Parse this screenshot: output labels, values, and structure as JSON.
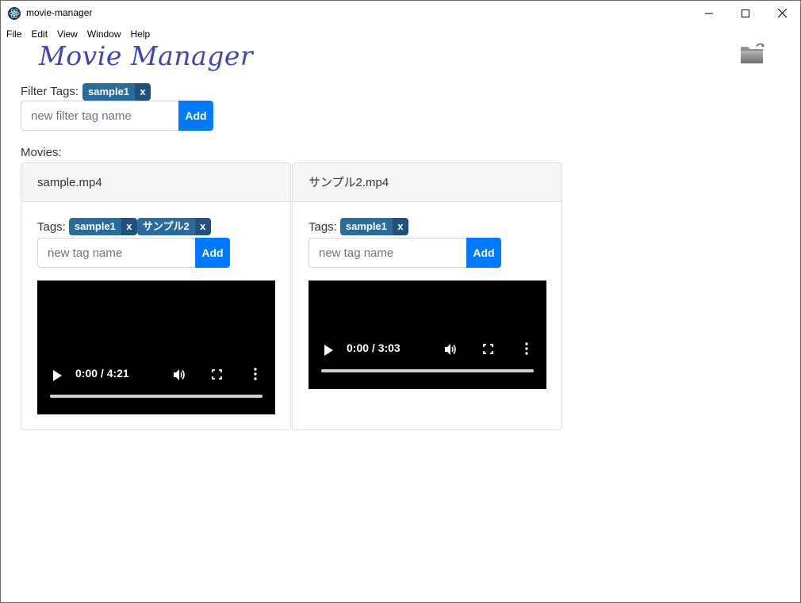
{
  "window": {
    "title": "movie-manager"
  },
  "menu": {
    "items": [
      "File",
      "Edit",
      "View",
      "Window",
      "Help"
    ]
  },
  "app": {
    "title": "Movie Manager",
    "folder_icon": "folder-open-icon"
  },
  "filter": {
    "label": "Filter Tags:",
    "tags": [
      {
        "name": "sample1",
        "delete_label": "x"
      }
    ],
    "placeholder": "new filter tag name",
    "add_label": "Add"
  },
  "movies": {
    "label": "Movies:",
    "items": [
      {
        "filename": "sample.mp4",
        "tags_label": "Tags:",
        "tags": [
          {
            "name": "sample1",
            "delete_label": "x"
          },
          {
            "name": "サンプル2",
            "delete_label": "x"
          }
        ],
        "placeholder": "new tag name",
        "add_label": "Add",
        "video": {
          "time": "0:00 / 4:21"
        }
      },
      {
        "filename": "サンプル2.mp4",
        "tags_label": "Tags:",
        "tags": [
          {
            "name": "sample1",
            "delete_label": "x"
          }
        ],
        "placeholder": "new tag name",
        "add_label": "Add",
        "video": {
          "time": "0:00 / 3:03"
        }
      }
    ]
  },
  "colors": {
    "title_color": "#3f45b8",
    "tag_bg": "#2a6b9e",
    "tag_delete_bg": "#22507a",
    "button_primary": "#007bff"
  }
}
